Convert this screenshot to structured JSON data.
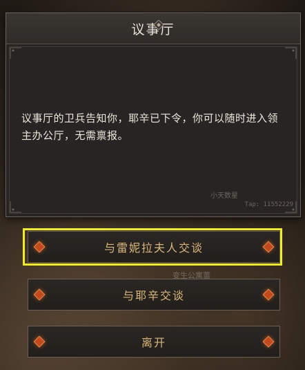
{
  "dialog": {
    "title": "议事厅",
    "body": "议事厅的卫兵告知你，耶辛已下令，你可以随时进入领主办公厅，无需禀报。",
    "watermark_name": "小天数星",
    "watermark_tap": "Tap: 11552229"
  },
  "options": [
    {
      "label": "与雷妮拉夫人交谈",
      "highlighted": true
    },
    {
      "label": "与耶辛交谈",
      "highlighted": false
    },
    {
      "label": "离开",
      "highlighted": false
    }
  ],
  "background_text": "变生公寓蔷",
  "colors": {
    "highlight": "#f2ee1a",
    "option_text": "#d9b77a",
    "gem": "#c44a1e"
  }
}
